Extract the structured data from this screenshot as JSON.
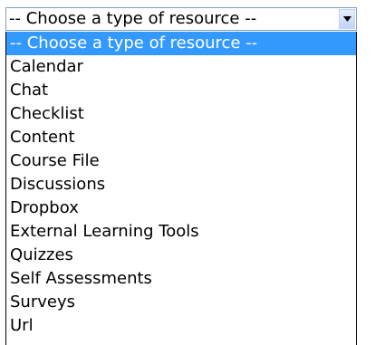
{
  "select": {
    "value": "-- Choose a type of resource --",
    "arrow_icon": "chevron-down-icon"
  },
  "options": [
    "-- Choose a type of resource --",
    "Calendar",
    "Chat",
    "Checklist",
    "Content",
    "Course File",
    "Discussions",
    "Dropbox",
    "External Learning Tools",
    "Quizzes",
    "Self Assessments",
    "Surveys",
    "Url"
  ],
  "highlighted_index": 0,
  "colors": {
    "highlight": "#3399ff",
    "border": "#7f9db9"
  }
}
